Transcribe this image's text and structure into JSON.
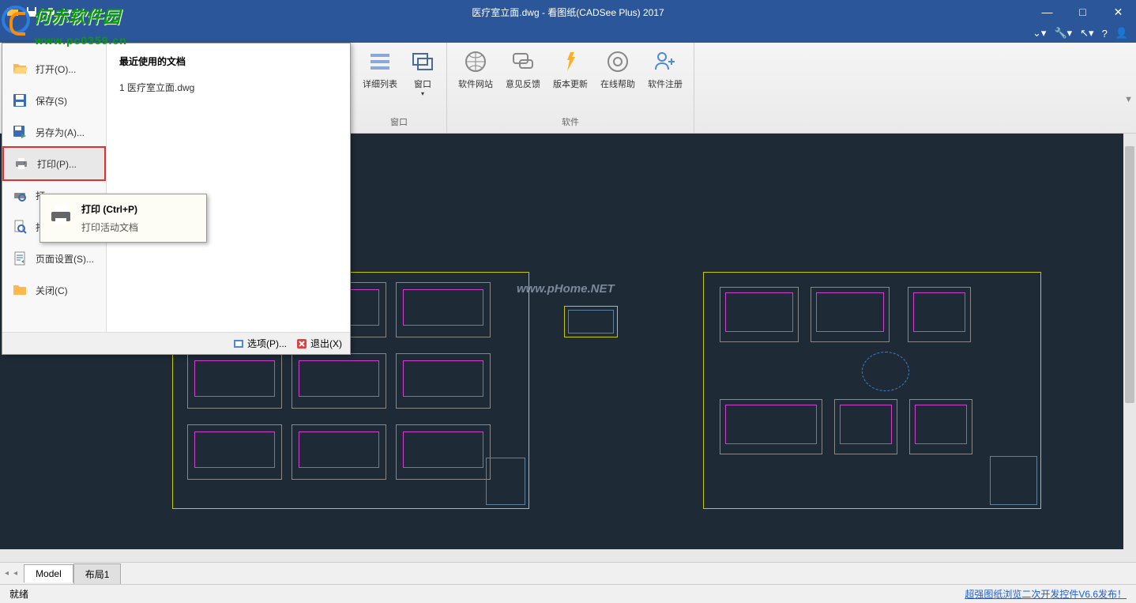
{
  "title": "医疗室立面.dwg - 看图纸(CADSee Plus) 2017",
  "logo": {
    "text": "何赤软件园",
    "url": "www.pc0359.cn"
  },
  "ribbon": {
    "group1_label": "窗口",
    "group2_label": "软件",
    "btn_detail": "详细列表",
    "btn_window": "窗口",
    "btn_website": "软件网站",
    "btn_feedback": "意见反馈",
    "btn_update": "版本更新",
    "btn_help": "在线帮助",
    "btn_register": "软件注册"
  },
  "file_menu": {
    "items": [
      {
        "label": "打开(O)...",
        "icon": "folder-open"
      },
      {
        "label": "保存(S)",
        "icon": "save"
      },
      {
        "label": "另存为(A)...",
        "icon": "save-as"
      },
      {
        "label": "打印(P)...",
        "icon": "print",
        "highlighted": true
      },
      {
        "label": "打",
        "icon": "print-preview"
      },
      {
        "label": "打",
        "icon": "find"
      },
      {
        "label": "页面设置(S)...",
        "icon": "page-setup"
      },
      {
        "label": "关闭(C)",
        "icon": "folder-close"
      }
    ],
    "recent_title": "最近使用的文档",
    "recent_items": [
      "1 医疗室立面.dwg"
    ],
    "footer_options": "选项(P)...",
    "footer_exit": "退出(X)"
  },
  "tooltip": {
    "title": "打印 (Ctrl+P)",
    "desc": "打印活动文档"
  },
  "canvas": {
    "watermark": "www.pHome.NET"
  },
  "tabs": {
    "model": "Model",
    "layout1": "布局1"
  },
  "status": {
    "ready": "就绪",
    "link": "超强图纸浏览二次开发控件V6.6发布！"
  }
}
